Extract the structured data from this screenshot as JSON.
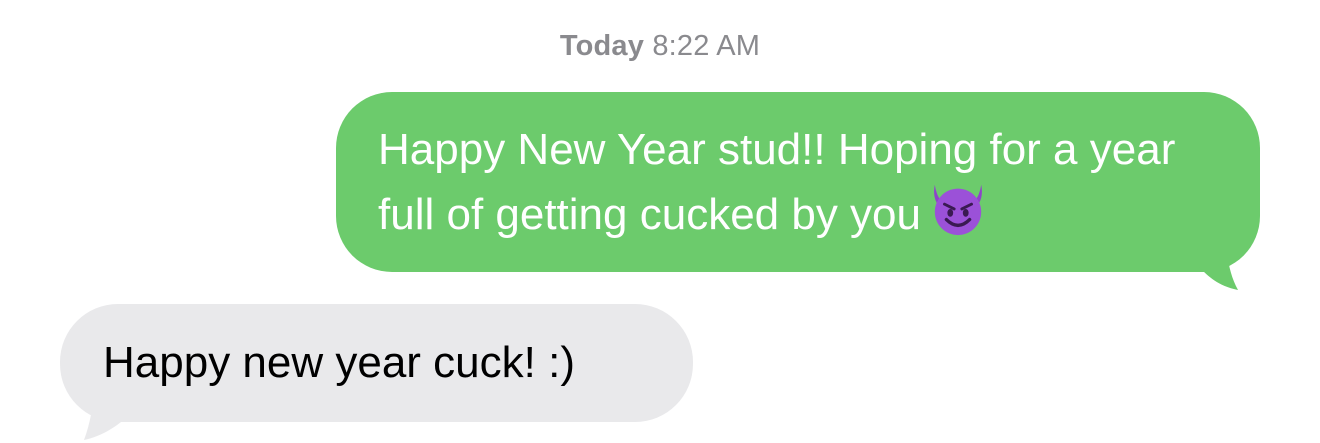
{
  "conversation": {
    "timestamp": {
      "day": "Today",
      "time": "8:22 AM"
    },
    "messages": [
      {
        "direction": "sent",
        "text": "Happy New Year stud!! Hoping for a year full of getting cucked by you",
        "emoji": "smiling-face-with-horns",
        "bubble_color": "#6ccb6c",
        "text_color": "#ffffff"
      },
      {
        "direction": "received",
        "text": "Happy new year cuck! :)",
        "bubble_color": "#e9e9eb",
        "text_color": "#000000"
      }
    ]
  }
}
